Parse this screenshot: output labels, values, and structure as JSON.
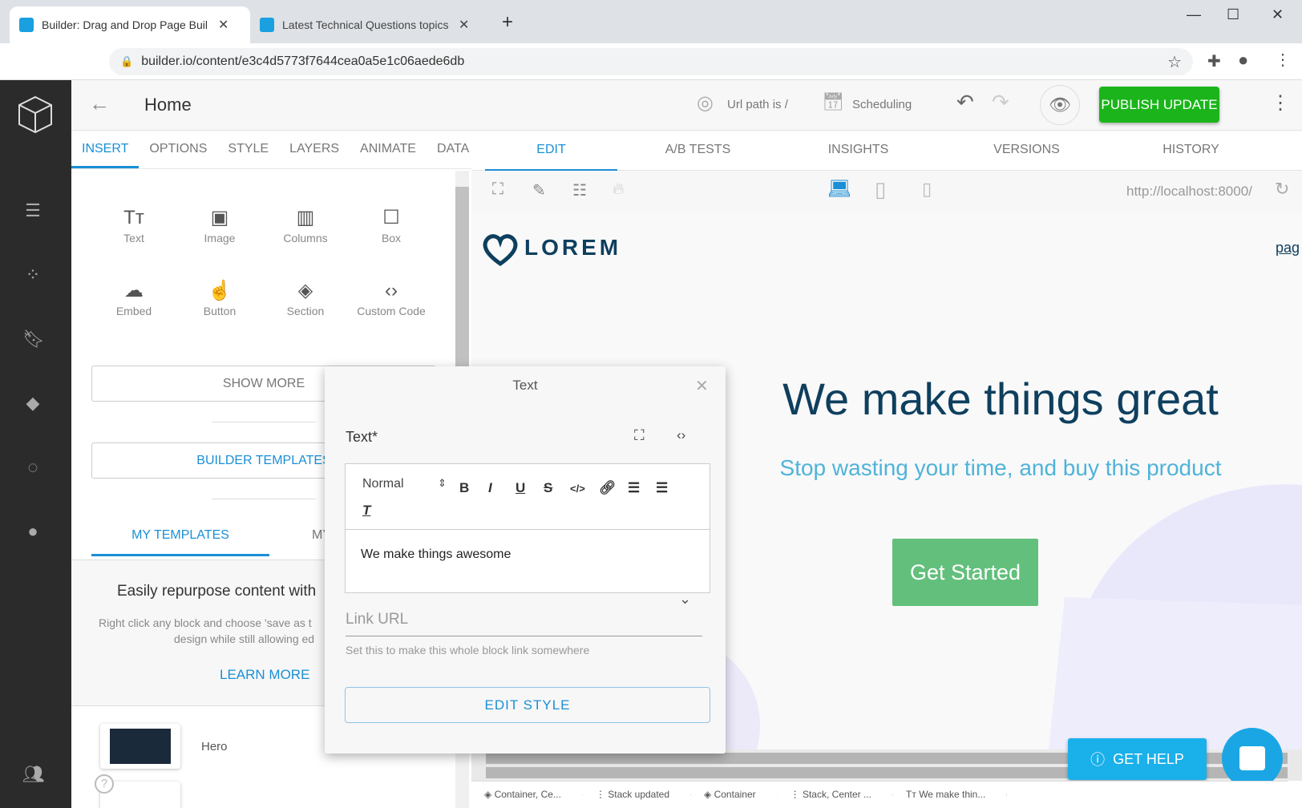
{
  "browser": {
    "tabs": [
      {
        "title": "Builder: Drag and Drop Page Buil"
      },
      {
        "title": "Latest Technical Questions topics"
      }
    ],
    "url": "builder.io/content/e3c4d5773f7644cea0a5e1c06aede6db"
  },
  "header": {
    "title": "Home",
    "url_path": "Url path is /",
    "scheduling": "Scheduling",
    "publish": "PUBLISH UPDATE"
  },
  "left_tabs": [
    "INSERT",
    "OPTIONS",
    "STYLE",
    "LAYERS",
    "ANIMATE",
    "DATA"
  ],
  "blocks": [
    {
      "label": "Text",
      "icon": "Tт"
    },
    {
      "label": "Image",
      "icon": "▣"
    },
    {
      "label": "Columns",
      "icon": "▥"
    },
    {
      "label": "Box",
      "icon": "☐"
    },
    {
      "label": "Embed",
      "icon": "☁"
    },
    {
      "label": "Button",
      "icon": "☝"
    },
    {
      "label": "Section",
      "icon": "◈"
    },
    {
      "label": "Custom Code",
      "icon": "‹›"
    }
  ],
  "show_more": "SHOW MORE",
  "builder_templates": "BUILDER TEMPLATES",
  "template_tabs": [
    "MY TEMPLATES",
    "MY"
  ],
  "templates_info": {
    "title": "Easily repurpose content with",
    "body1": "Right click any block and choose 'save as t",
    "body2": "design while still allowing ed",
    "learn_more": "LEARN MORE"
  },
  "template_items": [
    {
      "name": "Hero"
    }
  ],
  "right_tabs": [
    "EDIT",
    "A/B TESTS",
    "INSIGHTS",
    "VERSIONS",
    "HISTORY"
  ],
  "preview_url": "http://localhost:8000/",
  "page": {
    "logo": "LOREM",
    "nav_link": "pag",
    "headline": "We make things great",
    "subhead": "Stop wasting your time, and buy this product",
    "cta": "Get Started"
  },
  "modal": {
    "title": "Text",
    "field_label": "Text*",
    "format": "Normal",
    "value": "We make things awesome",
    "link_label": "Link URL",
    "link_help": "Set this to make this whole block link somewhere",
    "edit_style": "EDIT STYLE"
  },
  "get_help": "GET HELP",
  "breadcrumbs": [
    "Container, Ce...",
    "Stack updated",
    "Container",
    "Stack, Center ...",
    "We make thin..."
  ],
  "colors": {
    "accent": "#1a8fd6",
    "publish": "#1bb51b",
    "headline": "#0e3f5e",
    "subhead": "#4fb3d9",
    "cta": "#63bf7c"
  }
}
